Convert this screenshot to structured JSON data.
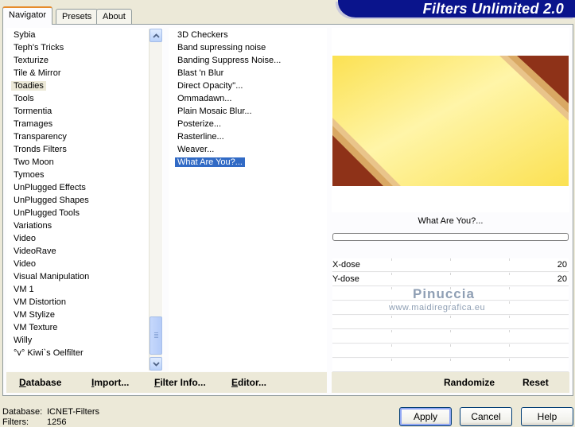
{
  "tabs": [
    {
      "label": "Navigator",
      "active": true
    },
    {
      "label": "Presets",
      "active": false
    },
    {
      "label": "About",
      "active": false
    }
  ],
  "banner": {
    "title": "Filters Unlimited 2.0",
    "color": "#0a148c"
  },
  "categories": {
    "items": [
      "Sybia",
      "Teph's Tricks",
      "Texturize",
      "Tile & Mirror",
      "Toadies",
      "Tools",
      "Tormentia",
      "Tramages",
      "Transparency",
      "Tronds Filters",
      "Two Moon",
      "Tymoes",
      "UnPlugged Effects",
      "UnPlugged Shapes",
      "UnPlugged Tools",
      "Variations",
      "Video",
      "VideoRave",
      "Video",
      "Visual Manipulation",
      "VM 1",
      "VM Distortion",
      "VM Stylize",
      "VM Texture",
      "Willy",
      "°v° Kiwi`s Oelfilter"
    ],
    "selected_index": 4
  },
  "filters": {
    "items": [
      "3D Checkers",
      "Band supressing noise",
      "Banding Suppress Noise...",
      "Blast 'n Blur",
      "Direct Opacity''...",
      "Ommadawn...",
      "Plain Mosaic Blur...",
      "Posterize...",
      "Rasterline...",
      "Weaver...",
      "What Are You?..."
    ],
    "selected_index": 10
  },
  "left_buttons": {
    "database": "Database",
    "import": "Import...",
    "filter_info": "Filter Info...",
    "editor": "Editor..."
  },
  "right_buttons": {
    "randomize": "Randomize",
    "reset": "Reset"
  },
  "preview": {
    "filter_name": "What Are You?...",
    "colors": {
      "yellow_light": "#fff5a8",
      "yellow": "#fbe152",
      "rust": "#8e3218",
      "tan": "#d9a863"
    }
  },
  "params": [
    {
      "label": "X-dose",
      "value": "20"
    },
    {
      "label": "Y-dose",
      "value": "20"
    }
  ],
  "watermark": {
    "name": "Pinuccia",
    "site": "www.maidiregrafica.eu"
  },
  "status": {
    "database_label": "Database:",
    "database_value": "ICNET-Filters",
    "filters_label": "Filters:",
    "filters_value": "1256"
  },
  "dialog_buttons": {
    "apply": "Apply",
    "cancel": "Cancel",
    "help": "Help"
  }
}
